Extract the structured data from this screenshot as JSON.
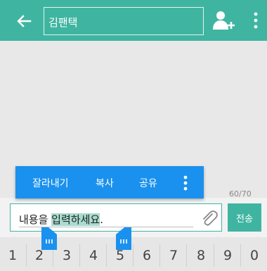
{
  "header": {
    "recipient": "김팬택",
    "back_icon": "arrow-left-icon",
    "add_contact_icon": "person-add-icon",
    "more_icon": "more-vertical-icon",
    "accent_color": "#3fb5a1"
  },
  "context_menu": {
    "cut_label": "잘라내기",
    "copy_label": "복사",
    "share_label": "공유",
    "more_icon": "more-vertical-icon",
    "background_color": "#1a91ee"
  },
  "compose": {
    "char_counter": "60/70",
    "text_before_selection": "내용을 ",
    "text_selected": "입력하세요",
    "text_after_selection": ".",
    "attach_icon": "paperclip-icon",
    "send_label": "전송"
  },
  "keyboard": {
    "keys": [
      "1",
      "2",
      "3",
      "4",
      "5",
      "6",
      "7",
      "8",
      "9",
      "0"
    ]
  }
}
